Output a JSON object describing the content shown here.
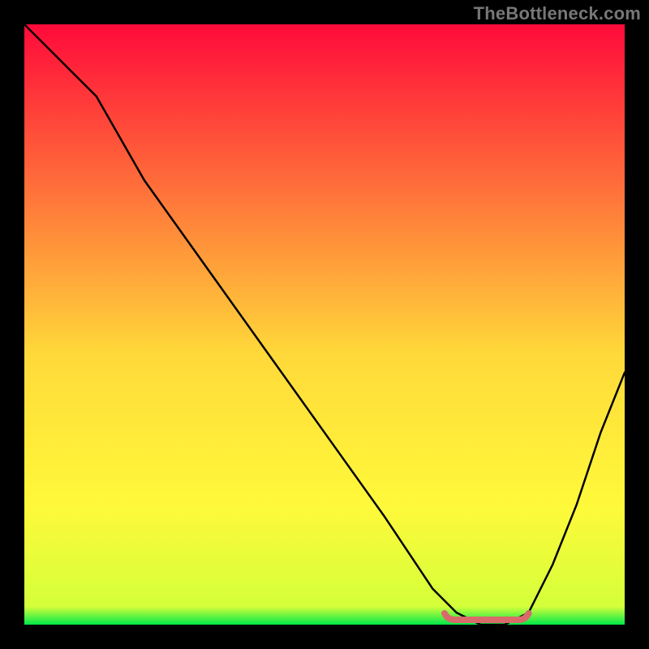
{
  "watermark": "TheBottleneck.com",
  "chart_data": {
    "type": "line",
    "title": "",
    "xlabel": "",
    "ylabel": "",
    "xlim": [
      0,
      100
    ],
    "ylim": [
      0,
      100
    ],
    "grid": false,
    "legend": false,
    "colors": {
      "gradient_top": "#ff0a3a",
      "gradient_mid_upper": "#ff7a3a",
      "gradient_mid": "#ffd93a",
      "gradient_mid_lower": "#fff93a",
      "gradient_bottom": "#00e84a",
      "background": "#000000",
      "curve": "#000000",
      "flat_marker": "#d86a6a"
    },
    "series": [
      {
        "name": "bottleneck-curve",
        "x": [
          0,
          5,
          8,
          12,
          20,
          30,
          40,
          50,
          60,
          68,
          72,
          76,
          80,
          84,
          88,
          92,
          96,
          100
        ],
        "values": [
          100,
          95,
          92,
          88,
          74,
          60,
          46,
          32,
          18,
          6,
          2,
          0,
          0,
          2,
          10,
          20,
          32,
          42
        ]
      }
    ],
    "flat_region": {
      "x_start": 70,
      "x_end": 84,
      "y": 0
    }
  }
}
